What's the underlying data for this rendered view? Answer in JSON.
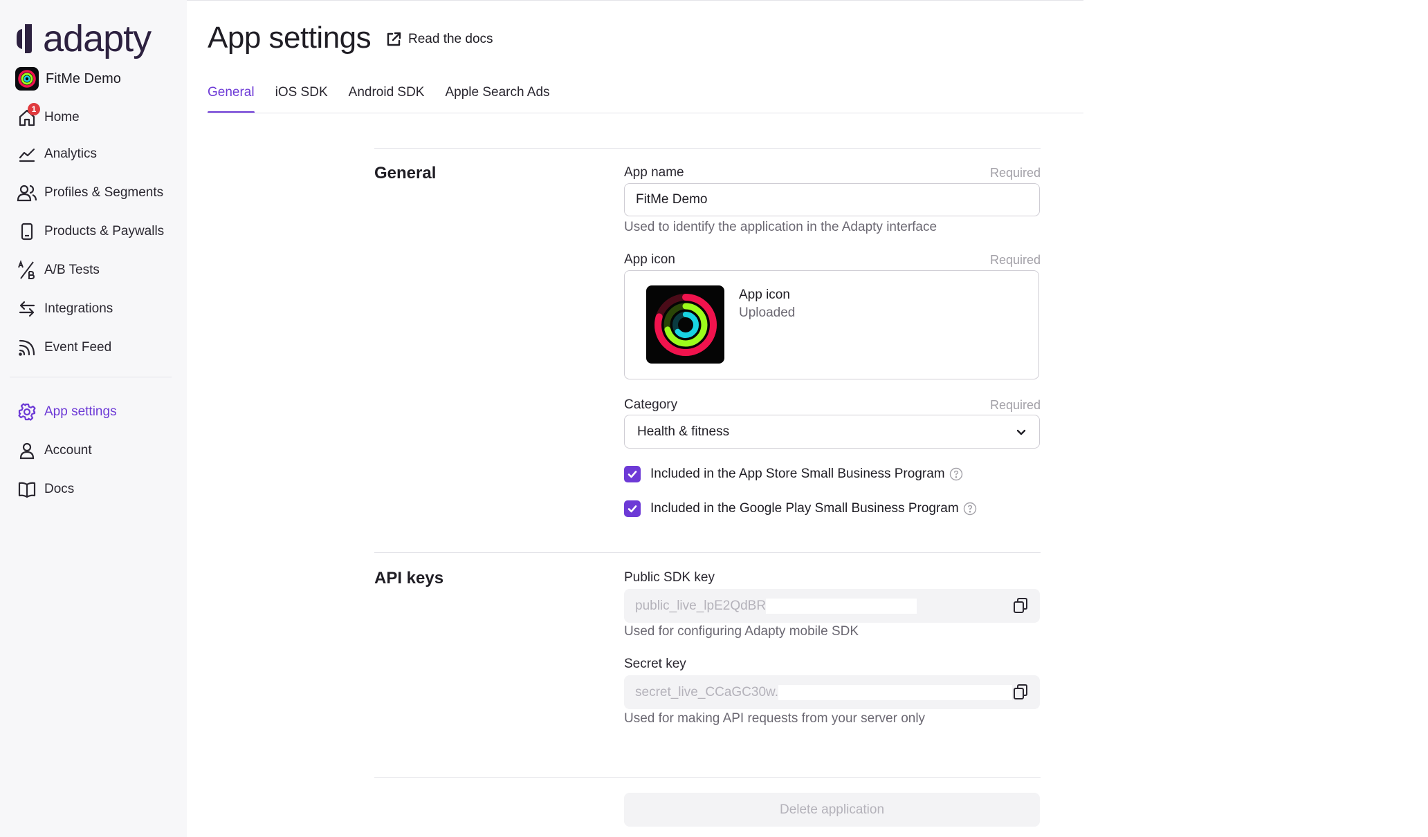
{
  "brand": {
    "name": "adapty",
    "accent": "#6d3ad6",
    "logo_color": "#2d2140"
  },
  "app": {
    "name": "FitMe Demo"
  },
  "sidebar": {
    "items": [
      {
        "label": "Home",
        "icon": "home-icon",
        "badge": "1"
      },
      {
        "label": "Analytics",
        "icon": "analytics-icon"
      },
      {
        "label": "Profiles & Segments",
        "icon": "users-icon"
      },
      {
        "label": "Products & Paywalls",
        "icon": "mobile-icon"
      },
      {
        "label": "A/B Tests",
        "icon": "ab-test-icon"
      },
      {
        "label": "Integrations",
        "icon": "arrows-icon"
      },
      {
        "label": "Event Feed",
        "icon": "feed-icon"
      },
      {
        "label": "App settings",
        "icon": "gear-icon",
        "active": true
      },
      {
        "label": "Account",
        "icon": "person-icon"
      },
      {
        "label": "Docs",
        "icon": "book-icon"
      }
    ]
  },
  "header": {
    "title": "App settings",
    "docs_link": "Read the docs"
  },
  "tabs": [
    {
      "label": "General",
      "active": true
    },
    {
      "label": "iOS SDK"
    },
    {
      "label": "Android SDK"
    },
    {
      "label": "Apple Search Ads"
    }
  ],
  "general": {
    "title": "General",
    "app_name": {
      "label": "App name",
      "required": "Required",
      "value": "FitMe Demo",
      "help": "Used to identify the application in the Adapty interface"
    },
    "app_icon": {
      "label": "App icon",
      "required": "Required",
      "name": "App icon",
      "status": "Uploaded"
    },
    "category": {
      "label": "Category",
      "required": "Required",
      "value": "Health & fitness"
    },
    "checkboxes": [
      {
        "label": "Included in the App Store Small Business Program",
        "checked": true
      },
      {
        "label": "Included in the Google Play Small Business Program",
        "checked": true
      }
    ]
  },
  "api_keys": {
    "title": "API keys",
    "public": {
      "label": "Public SDK key",
      "value": "public_live_lpE2QdBR",
      "help": "Used for configuring Adapty mobile SDK"
    },
    "secret": {
      "label": "Secret key",
      "value": "secret_live_CCaGC30w.",
      "help": "Used for making API requests from your server only"
    }
  },
  "delete_button": "Delete application"
}
